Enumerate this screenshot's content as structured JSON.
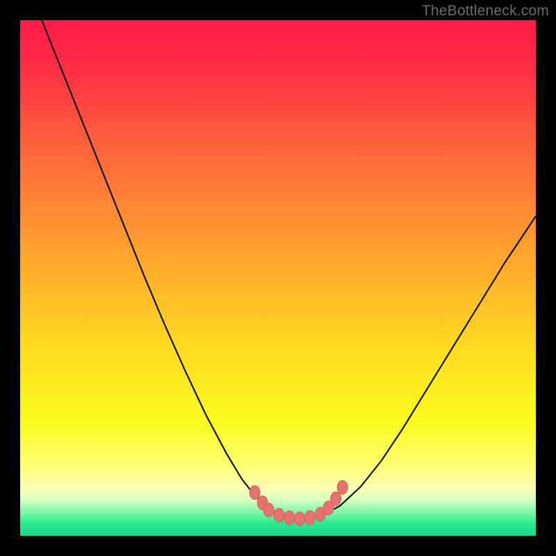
{
  "watermark": "TheBottleneck.com",
  "colors": {
    "frame": "#000000",
    "curve_stroke": "#111111",
    "bead_fill": "#e4736e",
    "bead_stroke": "#d25f5a",
    "gradient_stops": [
      {
        "offset": 0.0,
        "color": "#ff1a47"
      },
      {
        "offset": 0.1,
        "color": "#ff2f45"
      },
      {
        "offset": 0.22,
        "color": "#ff5a3d"
      },
      {
        "offset": 0.35,
        "color": "#ff8335"
      },
      {
        "offset": 0.5,
        "color": "#ffb22a"
      },
      {
        "offset": 0.65,
        "color": "#ffdf20"
      },
      {
        "offset": 0.78,
        "color": "#f9fb1e"
      },
      {
        "offset": 0.86,
        "color": "#ffff6e"
      },
      {
        "offset": 0.905,
        "color": "#ffffb0"
      },
      {
        "offset": 0.93,
        "color": "#d8ffc0"
      },
      {
        "offset": 0.955,
        "color": "#7cf7a8"
      },
      {
        "offset": 0.975,
        "color": "#2fe88e"
      },
      {
        "offset": 1.0,
        "color": "#12d98a"
      }
    ]
  },
  "chart_data": {
    "type": "line",
    "title": "",
    "xlabel": "",
    "ylabel": "",
    "xlim": [
      0,
      1
    ],
    "ylim": [
      0,
      1
    ],
    "note": "Axes are unlabeled. x and y are normalized to the plot area (0–1). y is plotted with 0 at the bottom.",
    "series": [
      {
        "name": "left-branch",
        "x": [
          0.042,
          0.08,
          0.12,
          0.16,
          0.2,
          0.24,
          0.28,
          0.32,
          0.36,
          0.4,
          0.43,
          0.455,
          0.475,
          0.495,
          0.515,
          0.535
        ],
        "y": [
          1.0,
          0.905,
          0.805,
          0.705,
          0.605,
          0.505,
          0.41,
          0.32,
          0.235,
          0.16,
          0.11,
          0.078,
          0.058,
          0.044,
          0.036,
          0.032
        ]
      },
      {
        "name": "right-branch",
        "x": [
          0.535,
          0.56,
          0.59,
          0.62,
          0.66,
          0.7,
          0.74,
          0.78,
          0.82,
          0.86,
          0.9,
          0.94,
          0.98,
          1.0
        ],
        "y": [
          0.032,
          0.034,
          0.042,
          0.058,
          0.095,
          0.145,
          0.205,
          0.27,
          0.335,
          0.4,
          0.465,
          0.53,
          0.59,
          0.62
        ]
      }
    ],
    "markers": {
      "name": "beads",
      "points": [
        {
          "x": 0.455,
          "y": 0.084
        },
        {
          "x": 0.47,
          "y": 0.064
        },
        {
          "x": 0.482,
          "y": 0.05
        },
        {
          "x": 0.502,
          "y": 0.04
        },
        {
          "x": 0.522,
          "y": 0.035
        },
        {
          "x": 0.542,
          "y": 0.033
        },
        {
          "x": 0.562,
          "y": 0.035
        },
        {
          "x": 0.582,
          "y": 0.042
        },
        {
          "x": 0.598,
          "y": 0.054
        },
        {
          "x": 0.612,
          "y": 0.072
        },
        {
          "x": 0.625,
          "y": 0.094
        }
      ]
    }
  }
}
